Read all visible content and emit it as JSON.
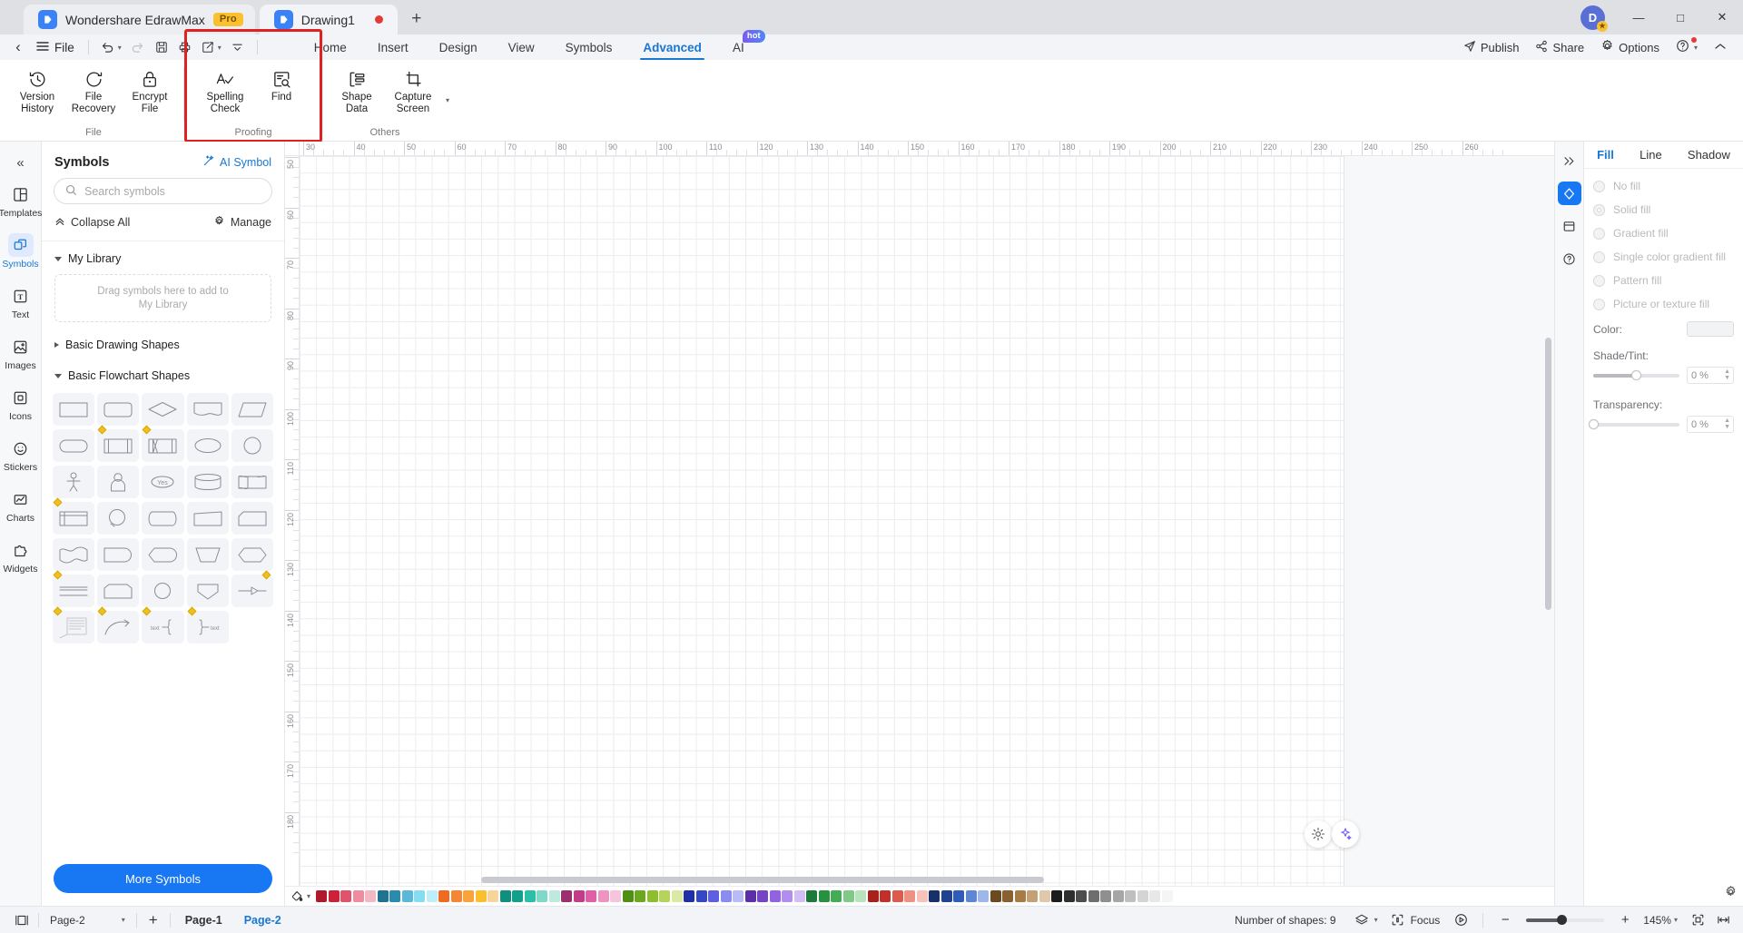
{
  "titlebar": {
    "app_tab": {
      "label": "Wondershare EdrawMax",
      "badge": "Pro",
      "icon": "edraw-logo-icon"
    },
    "doc_tab": {
      "label": "Drawing1",
      "icon": "document-icon",
      "modified": true
    },
    "new_tab_label": "+",
    "avatar_initial": "D",
    "window_controls": {
      "minimize": "—",
      "maximize": "□",
      "close": "✕"
    }
  },
  "menurow": {
    "back_label": "‹",
    "file_label": "File",
    "qat": [
      {
        "name": "undo",
        "label": "↶"
      },
      {
        "name": "redo",
        "label": "↷"
      },
      {
        "name": "save",
        "label": "save-icon"
      },
      {
        "name": "print",
        "label": "print-icon"
      },
      {
        "name": "export",
        "label": "export-icon"
      },
      {
        "name": "customize",
        "label": "⌄"
      }
    ],
    "tabs": [
      {
        "label": "Home",
        "active": false
      },
      {
        "label": "Insert",
        "active": false
      },
      {
        "label": "Design",
        "active": false
      },
      {
        "label": "View",
        "active": false
      },
      {
        "label": "Symbols",
        "active": false
      },
      {
        "label": "Advanced",
        "active": true
      },
      {
        "label": "AI",
        "active": false,
        "badge": "hot"
      }
    ],
    "right_items": [
      {
        "label": "Publish",
        "icon": "publish-icon"
      },
      {
        "label": "Share",
        "icon": "share-icon"
      },
      {
        "label": "Options",
        "icon": "gear-icon"
      },
      {
        "label": "",
        "icon": "help-icon"
      },
      {
        "label": "",
        "icon": "collapse-ribbon-icon"
      }
    ]
  },
  "ribbon": {
    "groups": [
      {
        "name": "File",
        "label": "File",
        "items": [
          {
            "label": "Version\nHistory",
            "icon": "version-history-icon"
          },
          {
            "label": "File\nRecovery",
            "icon": "file-recovery-icon"
          },
          {
            "label": "Encrypt\nFile",
            "icon": "lock-icon"
          }
        ]
      },
      {
        "name": "Proofing",
        "label": "Proofing",
        "highlighted": true,
        "items": [
          {
            "label": "Spelling\nCheck",
            "icon": "spelling-check-icon"
          },
          {
            "label": "Find",
            "icon": "find-icon"
          }
        ]
      },
      {
        "name": "Others",
        "label": "Others",
        "items": [
          {
            "label": "Shape\nData",
            "icon": "shape-data-icon"
          },
          {
            "label": "Capture\nScreen",
            "icon": "capture-screen-icon",
            "has_dropdown": true
          }
        ]
      }
    ],
    "highlight_color": "#e02121"
  },
  "left_rail": {
    "collapse_label": "«",
    "items": [
      {
        "label": "Templates",
        "icon": "templates-icon",
        "active": false
      },
      {
        "label": "Symbols",
        "icon": "symbols-icon",
        "active": true
      },
      {
        "label": "Text",
        "icon": "text-icon",
        "active": false
      },
      {
        "label": "Images",
        "icon": "images-icon",
        "active": false
      },
      {
        "label": "Icons",
        "icon": "icons-icon",
        "active": false
      },
      {
        "label": "Stickers",
        "icon": "stickers-icon",
        "active": false
      },
      {
        "label": "Charts",
        "icon": "charts-icon",
        "active": false
      },
      {
        "label": "Widgets",
        "icon": "widgets-icon",
        "active": false
      }
    ]
  },
  "symbols_panel": {
    "title": "Symbols",
    "ai_symbol_label": "AI Symbol",
    "search_placeholder": "Search symbols",
    "search_value": "",
    "collapse_all_label": "Collapse All",
    "manage_label": "Manage",
    "groups": [
      {
        "label": "My Library",
        "expanded": true,
        "dropzone": "Drag symbols here to add to\nMy Library"
      },
      {
        "label": "Basic Drawing Shapes",
        "expanded": false
      },
      {
        "label": "Basic Flowchart Shapes",
        "expanded": true
      }
    ],
    "shapes": [
      {
        "name": "process-rectangle",
        "badge": false
      },
      {
        "name": "rounded-rectangle",
        "badge": false
      },
      {
        "name": "decision-diamond",
        "badge": false
      },
      {
        "name": "document",
        "badge": false
      },
      {
        "name": "data-parallelogram",
        "badge": false
      },
      {
        "name": "terminator-stadium",
        "badge": false
      },
      {
        "name": "predefined-process",
        "badge": true
      },
      {
        "name": "alternate-process",
        "badge": true
      },
      {
        "name": "ellipse",
        "badge": false
      },
      {
        "name": "circle",
        "badge": false
      },
      {
        "name": "actor-person",
        "badge": false
      },
      {
        "name": "user-avatar",
        "badge": false
      },
      {
        "name": "yes-oval",
        "badge": false
      },
      {
        "name": "database-cylinder",
        "badge": false
      },
      {
        "name": "multi-document",
        "badge": false
      },
      {
        "name": "internal-storage",
        "badge": true
      },
      {
        "name": "connector-circle",
        "badge": false
      },
      {
        "name": "direct-data",
        "badge": false
      },
      {
        "name": "trapezoid-slant",
        "badge": false
      },
      {
        "name": "card",
        "badge": false
      },
      {
        "name": "wave-document",
        "badge": false
      },
      {
        "name": "delay",
        "badge": false
      },
      {
        "name": "display",
        "badge": false
      },
      {
        "name": "manual-operation",
        "badge": false
      },
      {
        "name": "hexagon-preparation",
        "badge": false
      },
      {
        "name": "annotation-lines",
        "badge": true
      },
      {
        "name": "stored-data",
        "badge": false
      },
      {
        "name": "or-circle",
        "badge": false
      },
      {
        "name": "extract-pentagon",
        "badge": false
      },
      {
        "name": "arrow-connector",
        "badge": true
      },
      {
        "name": "text-note",
        "badge": true
      },
      {
        "name": "curved-arrow",
        "badge": true
      },
      {
        "name": "left-brace",
        "badge": true
      },
      {
        "name": "right-brace",
        "badge": true
      }
    ],
    "more_symbols_label": "More Symbols"
  },
  "canvas": {
    "ruler_h_labels": [
      "30",
      "40",
      "50",
      "60",
      "70",
      "80",
      "90",
      "100",
      "110",
      "120",
      "130",
      "140",
      "150",
      "160",
      "170",
      "180",
      "190",
      "200",
      "210",
      "220",
      "230",
      "240",
      "250",
      "260"
    ],
    "ruler_v_labels": [
      "50",
      "60",
      "70",
      "80",
      "90",
      "100",
      "110",
      "120",
      "130",
      "140",
      "150",
      "160",
      "170",
      "180"
    ],
    "fab_buttons": [
      {
        "name": "quick-style-icon"
      },
      {
        "name": "ai-assistant-icon"
      }
    ],
    "palette_tool": "fill-color-icon",
    "palette_colors": [
      "#b0182c",
      "#cc2139",
      "#e0536a",
      "#ef8ca0",
      "#f4b7c4",
      "#1f7390",
      "#2a8bb0",
      "#5ab8d8",
      "#86dcf0",
      "#bdeefa",
      "#f06a21",
      "#f58634",
      "#f9a33c",
      "#fbbf2e",
      "#f7d59a",
      "#0f8f7e",
      "#12a08c",
      "#2cbfa8",
      "#7fd9c8",
      "#bde9df",
      "#9c2f6e",
      "#c13d89",
      "#e05fa6",
      "#ef93c3",
      "#f7c4dd",
      "#4f8f14",
      "#6aa81c",
      "#8dbe2b",
      "#b6d45c",
      "#dbe9a4",
      "#1e2fa8",
      "#3448c4",
      "#5b5fe0",
      "#8a8cf0",
      "#b9bbf7",
      "#5b2fa8",
      "#7444c4",
      "#9263e0",
      "#b18df0",
      "#d3bdf7",
      "#1c7a3a",
      "#26913f",
      "#43ad55",
      "#7fca86",
      "#b8e3bc",
      "#a8221c",
      "#c3302a",
      "#dd5a4c",
      "#ef9182",
      "#f7c3b8",
      "#16306e",
      "#1f4390",
      "#2f5cb8",
      "#5f86d4",
      "#9db8e8",
      "#6b4a22",
      "#8a6030",
      "#a87a45",
      "#c5a074",
      "#e0c9aa",
      "#1c1c1c",
      "#2e2e2e",
      "#4d4d4d",
      "#6e6e6e",
      "#8f8f8f",
      "#a6a6a6",
      "#bfbfbf",
      "#d4d4d4",
      "#e8e8e8",
      "#f5f5f5"
    ]
  },
  "right_rail": {
    "items": [
      {
        "name": "expand-panel-icon",
        "label": "»",
        "active": false
      },
      {
        "name": "fill-style-icon",
        "label": "",
        "active": true
      },
      {
        "name": "layout-icon",
        "label": "",
        "active": false
      },
      {
        "name": "help-panel-icon",
        "label": "?",
        "active": false
      }
    ]
  },
  "properties": {
    "tabs": [
      {
        "label": "Fill",
        "active": true
      },
      {
        "label": "Line",
        "active": false
      },
      {
        "label": "Shadow",
        "active": false
      }
    ],
    "fill_options": [
      {
        "label": "No fill",
        "selected": false
      },
      {
        "label": "Solid fill",
        "selected": true
      },
      {
        "label": "Gradient fill",
        "selected": false
      },
      {
        "label": "Single color gradient fill",
        "selected": false
      },
      {
        "label": "Pattern fill",
        "selected": false
      },
      {
        "label": "Picture or texture fill",
        "selected": false
      }
    ],
    "color_label": "Color:",
    "color_value": "#f2f3f5",
    "shade_label": "Shade/Tint:",
    "shade_value": "0 %",
    "shade_pct": 50,
    "transparency_label": "Transparency:",
    "transparency_value": "0 %",
    "transparency_pct": 0,
    "settings_icon": "gear-icon"
  },
  "statusbar": {
    "layout_icon": "page-layout-icon",
    "current_page": "Page-2",
    "add_page_label": "+",
    "page_tabs": [
      {
        "label": "Page-1",
        "current": false
      },
      {
        "label": "Page-2",
        "current": true
      }
    ],
    "shapes_count_label": "Number of shapes: 9",
    "layers_icon": "layers-icon",
    "focus_label": "Focus",
    "present_icon": "present-icon",
    "zoom_out_label": "−",
    "zoom_in_label": "+",
    "zoom_level": "145%",
    "fit_page_icon": "fit-page-icon",
    "fit_width_icon": "fit-width-icon"
  }
}
